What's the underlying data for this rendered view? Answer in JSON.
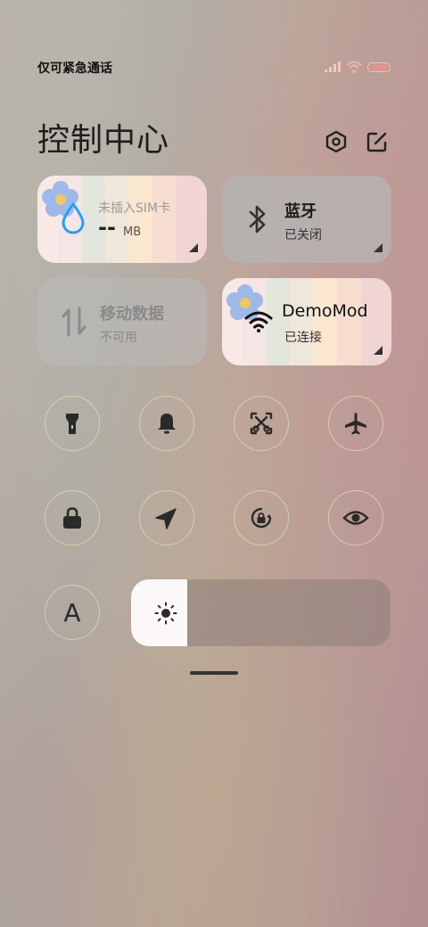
{
  "status_bar": {
    "carrier_text": "仅可紧急通话",
    "icons": [
      "signal-icon",
      "wifi-icon",
      "battery-icon"
    ],
    "battery_level": 0.85
  },
  "header": {
    "title": "控制中心",
    "icons": [
      "settings-icon",
      "edit-icon"
    ]
  },
  "tiles": {
    "data_usage": {
      "sim_label": "未插入SIM卡",
      "value": "--",
      "unit": "MB",
      "icon": "water-drop-icon"
    },
    "bluetooth": {
      "label": "蓝牙",
      "status": "已关闭",
      "icon": "bluetooth-icon"
    },
    "mobile_data": {
      "label": "移动数据",
      "status": "不可用",
      "icon": "mobile-data-icon"
    },
    "wifi": {
      "label": "DemoMod",
      "status": "已连接",
      "icon": "wifi-icon"
    }
  },
  "toggles": [
    {
      "icon": "flashlight-icon"
    },
    {
      "icon": "bell-icon"
    },
    {
      "icon": "screenshot-icon"
    },
    {
      "icon": "airplane-icon"
    },
    {
      "icon": "lock-icon"
    },
    {
      "icon": "location-icon"
    },
    {
      "icon": "rotation-lock-icon"
    },
    {
      "icon": "eye-icon"
    },
    {
      "icon": "font-size-icon",
      "label": "A"
    }
  ],
  "brightness": {
    "icon": "sun-icon",
    "level": 0.22
  },
  "colors": {
    "accent_blue": "#2a9df4",
    "flower_blue": "#9fb8e8",
    "flower_center": "#f2c66b"
  }
}
